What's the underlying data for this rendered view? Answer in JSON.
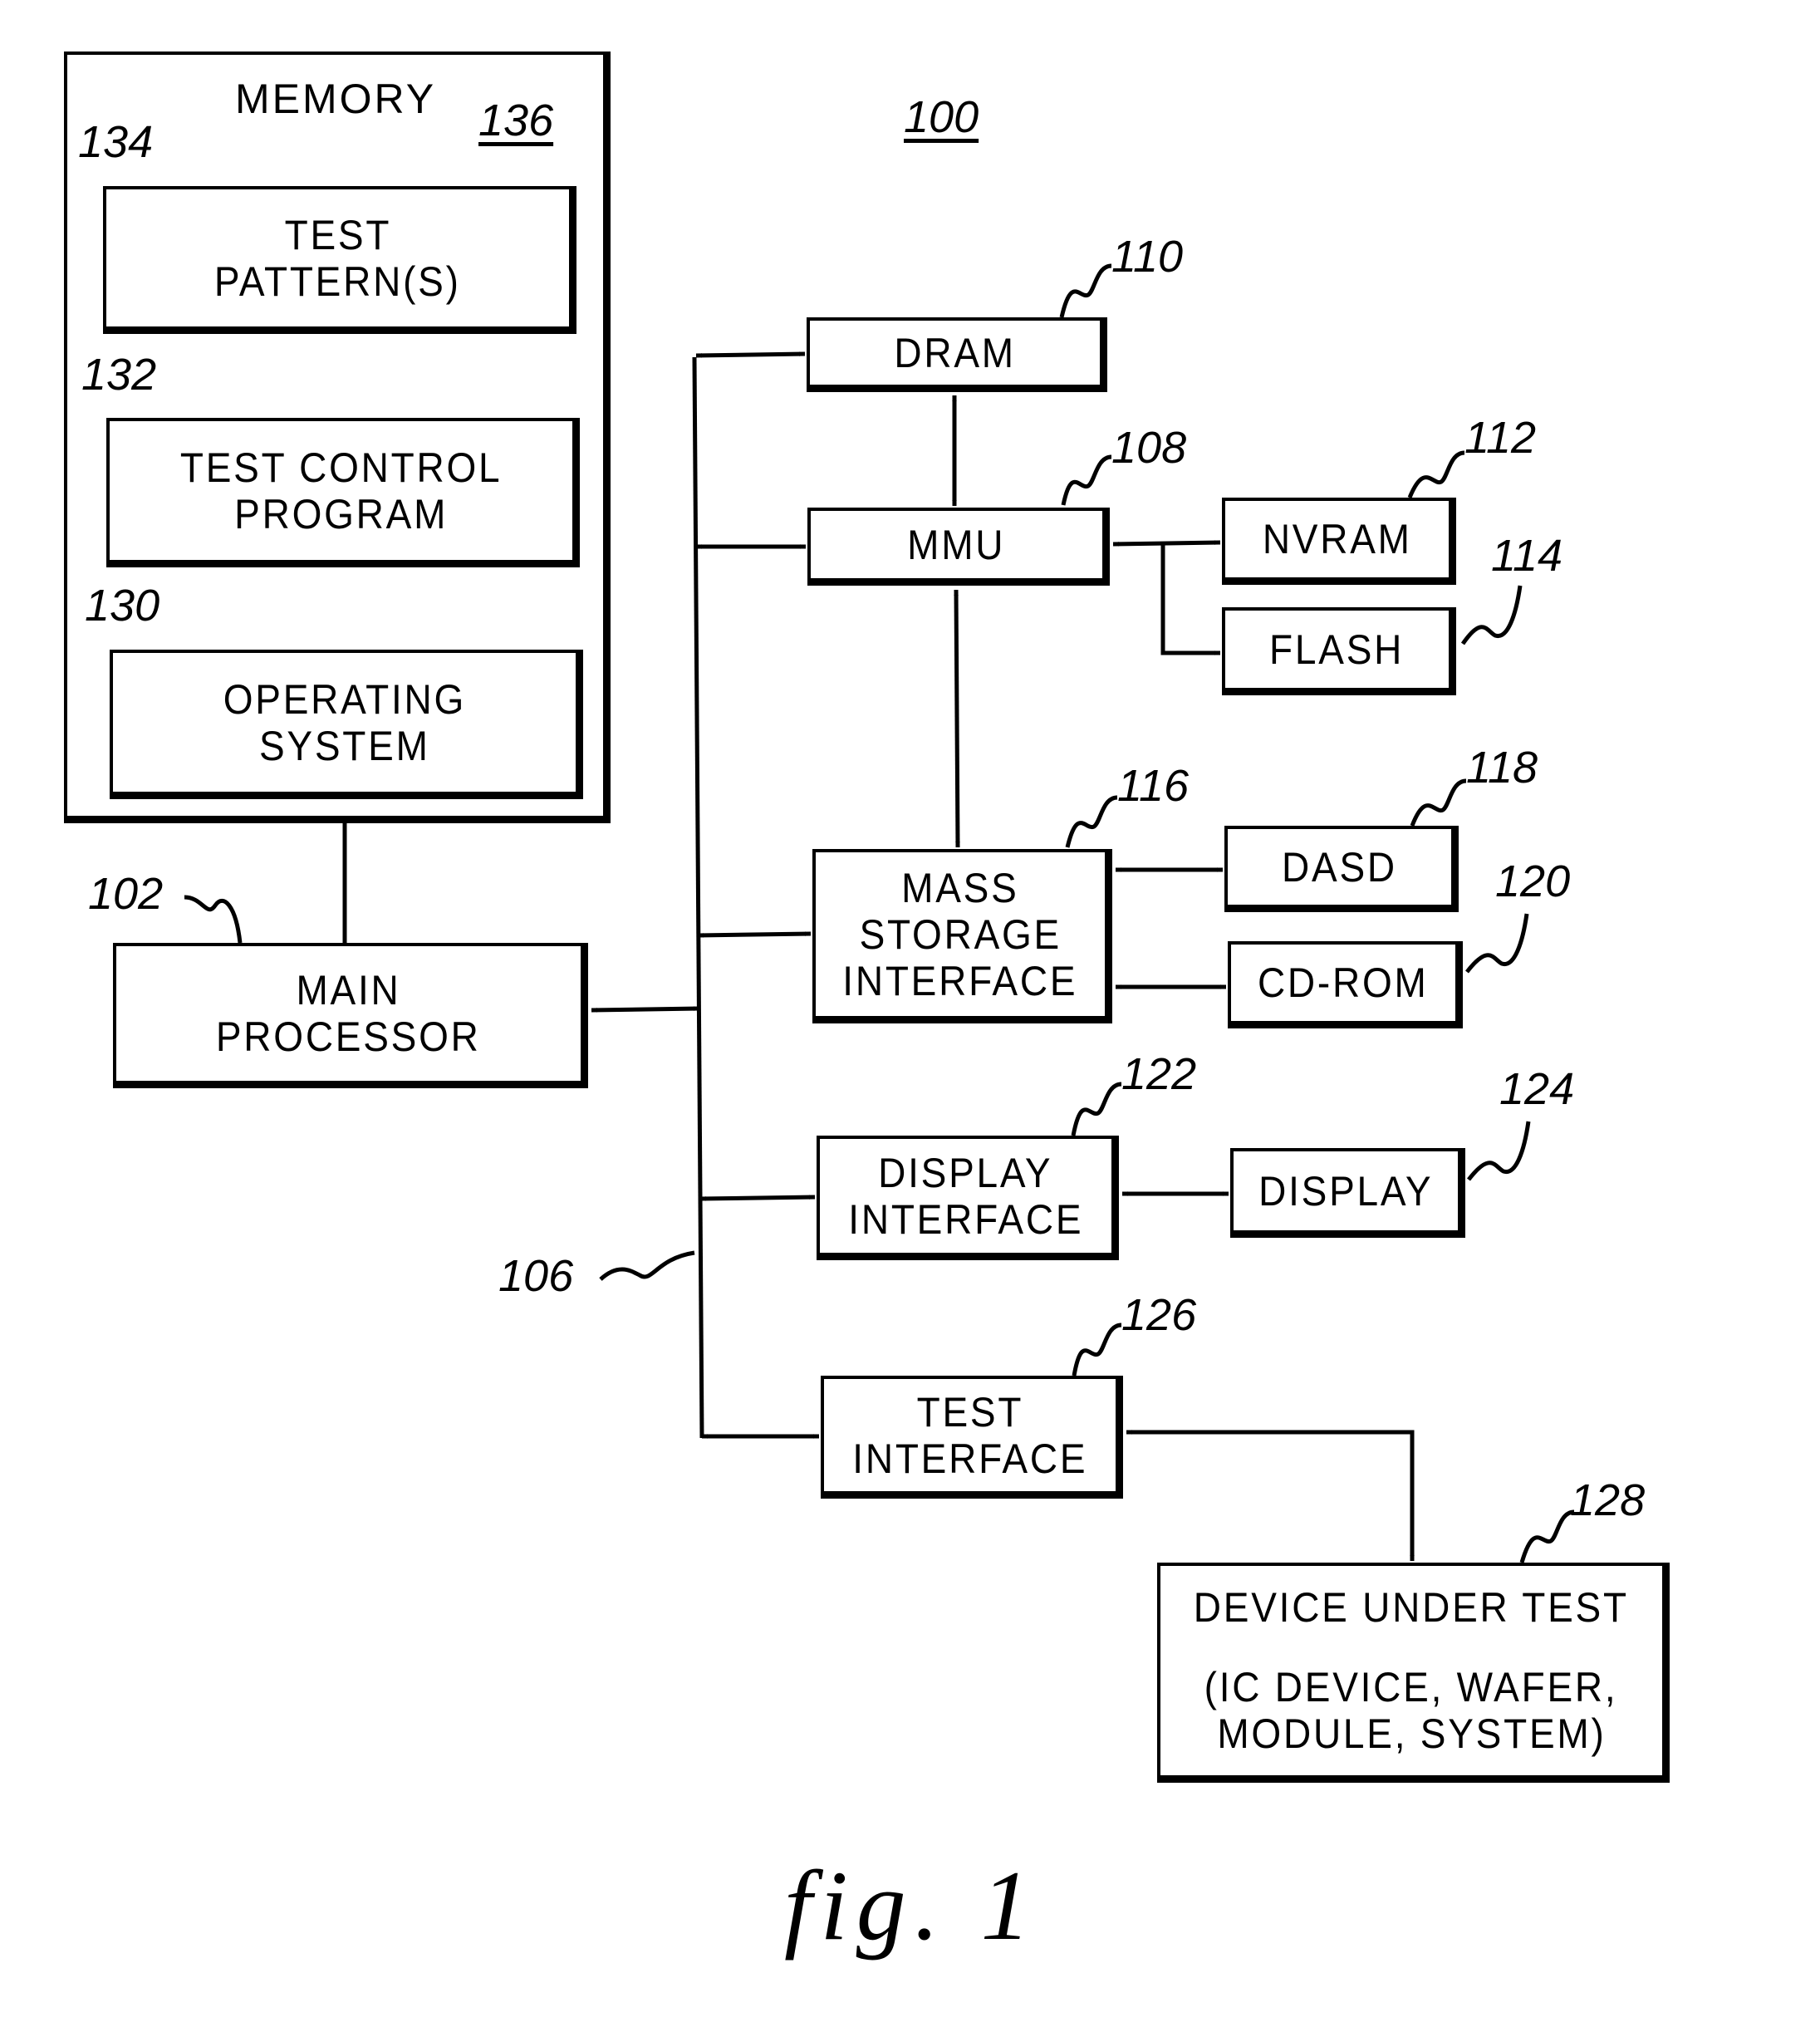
{
  "figure": {
    "label": "fig. 1",
    "system_ref": "100"
  },
  "memory": {
    "title": "MEMORY",
    "ref": "136",
    "blocks": [
      {
        "id": "test-patterns",
        "lines": [
          "TEST",
          "PATTERN(S)"
        ],
        "ref": "134"
      },
      {
        "id": "test-control-program",
        "lines": [
          "TEST CONTROL",
          "PROGRAM"
        ],
        "ref": "132"
      },
      {
        "id": "operating-system",
        "lines": [
          "OPERATING",
          "SYSTEM"
        ],
        "ref": "130"
      }
    ]
  },
  "main_processor": {
    "lines": [
      "MAIN",
      "PROCESSOR"
    ],
    "ref": "102"
  },
  "bus": {
    "ref": "106"
  },
  "dram": {
    "lines": [
      "DRAM"
    ],
    "ref": "110"
  },
  "mmu": {
    "lines": [
      "MMU"
    ],
    "ref": "108"
  },
  "nvram": {
    "lines": [
      "NVRAM"
    ],
    "ref": "112"
  },
  "flash": {
    "lines": [
      "FLASH"
    ],
    "ref": "114"
  },
  "mass_storage_interface": {
    "lines": [
      "MASS",
      "STORAGE",
      "INTERFACE"
    ],
    "ref": "116"
  },
  "dasd": {
    "lines": [
      "DASD"
    ],
    "ref": "118"
  },
  "cd_rom": {
    "lines": [
      "CD-ROM"
    ],
    "ref": "120"
  },
  "display_interface": {
    "lines": [
      "DISPLAY",
      "INTERFACE"
    ],
    "ref": "122"
  },
  "display": {
    "lines": [
      "DISPLAY"
    ],
    "ref": "124"
  },
  "test_interface": {
    "lines": [
      "TEST",
      "INTERFACE"
    ],
    "ref": "126"
  },
  "device_under_test": {
    "lines": [
      "DEVICE UNDER TEST",
      "",
      "(IC DEVICE, WAFER,",
      "MODULE, SYSTEM)"
    ],
    "ref": "128"
  }
}
